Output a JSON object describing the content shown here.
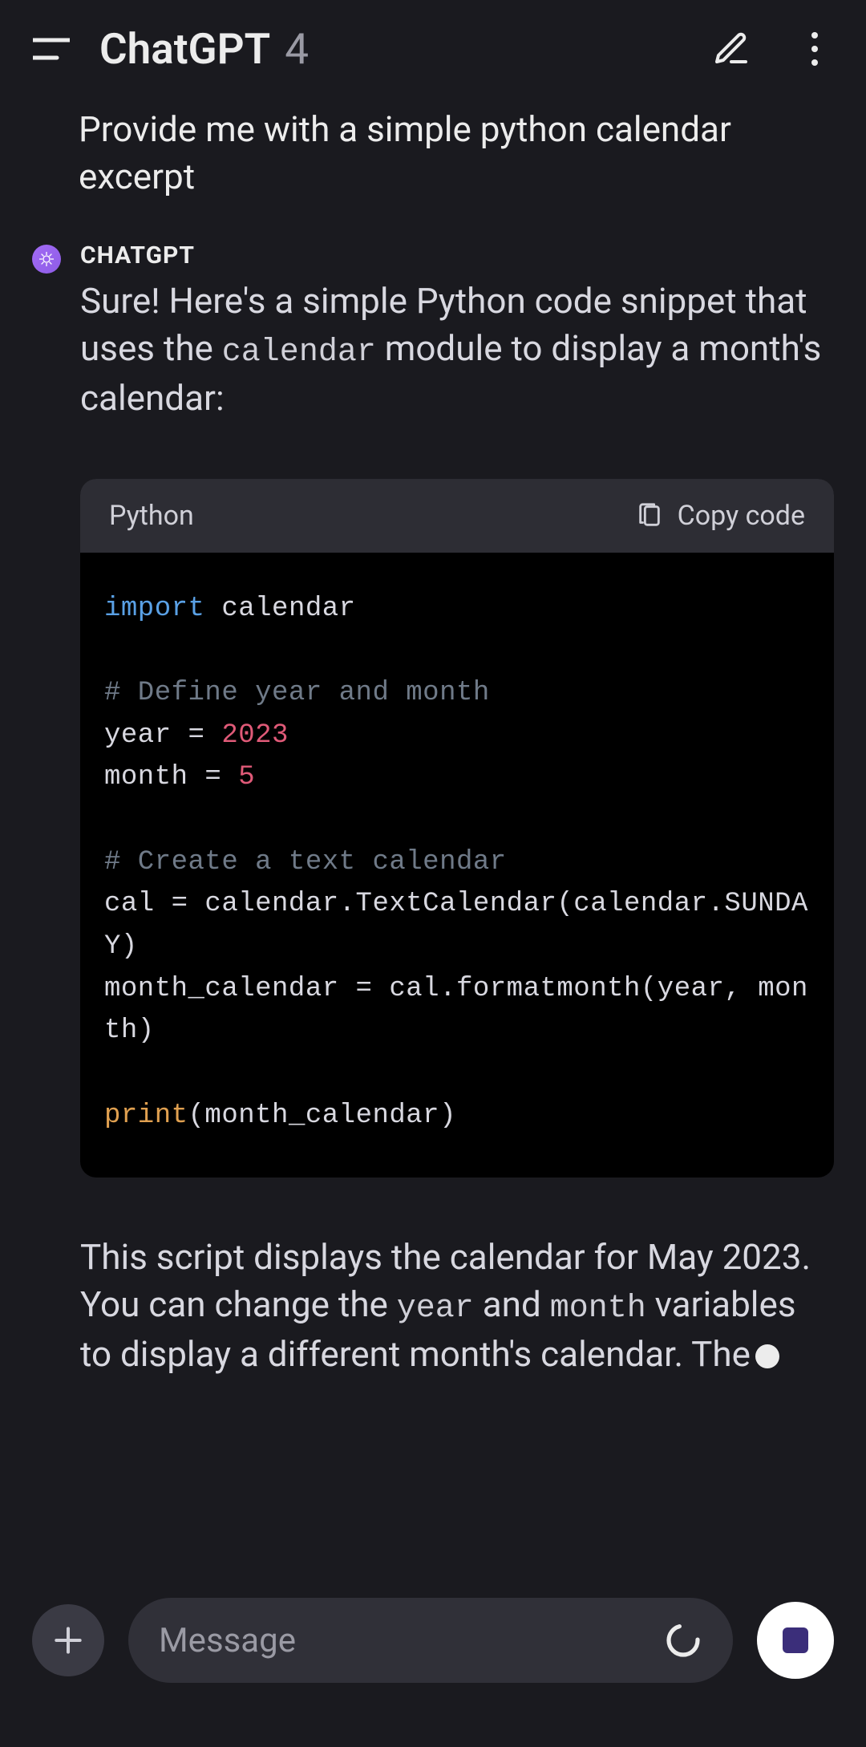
{
  "header": {
    "title": "ChatGPT",
    "version": "4"
  },
  "user": {
    "message": "Provide me with a simple python calendar excerpt"
  },
  "assistant": {
    "label": "CHATGPT",
    "intro_part1": "Sure! Here's a simple Python code snippet that uses the ",
    "intro_code": "calendar",
    "intro_part2": " module to display a month's calendar:",
    "outro_part1": "This script displays the calendar for May 2023. You can change the ",
    "outro_code1": "year",
    "outro_mid": " and ",
    "outro_code2": "month",
    "outro_part2": " variables to display a different month's calendar. The"
  },
  "codeblock": {
    "language": "Python",
    "copy_label": "Copy code",
    "tok_import": "import",
    "tok_calendar": " calendar",
    "tok_com1": "# Define year and month",
    "tok_year": "year = ",
    "tok_2023": "2023",
    "tok_month": "month = ",
    "tok_5": "5",
    "tok_com2": "# Create a text calendar",
    "tok_cal1": "cal = calendar.TextCalendar(calendar.SUNDAY)",
    "tok_cal2": "month_calendar = cal.formatmonth(year, month)",
    "tok_print": "print",
    "tok_printarg": "(month_calendar)"
  },
  "input": {
    "placeholder": "Message"
  },
  "icons": {
    "menu": "menu-icon",
    "compose": "compose-icon",
    "more": "more-options-icon",
    "clipboard": "clipboard-icon",
    "plus": "plus-icon",
    "loading": "loading-icon",
    "stop": "stop-icon"
  },
  "colors": {
    "bg": "#1a1a1f",
    "text": "#ececec",
    "muted": "#9a9aa4",
    "code_bg": "#000000",
    "code_header_bg": "#2d2d34",
    "avatar": "#8e5ce6",
    "input_bg": "#303038"
  }
}
